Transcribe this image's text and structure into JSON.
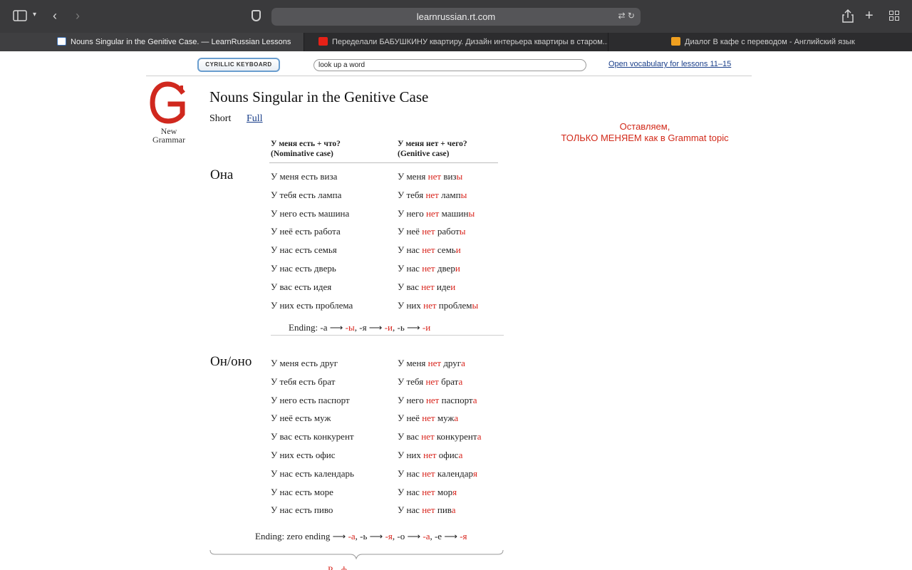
{
  "browser": {
    "url": "learnrussian.rt.com",
    "tabs": [
      {
        "title": "Nouns Singular in the Genitive Case. — LearnRussian Lessons",
        "active": true,
        "favicon": "lr-icon"
      },
      {
        "title": "Переделали БАБУШКИНУ квартиру. Дизайн интерьера квартиры в старом...",
        "active": false,
        "favicon": "youtube-icon"
      },
      {
        "title": "Диалог В кафе с переводом - Английский язык",
        "active": false,
        "favicon": "site-icon"
      }
    ]
  },
  "page": {
    "keyboard_button": "CYRILLIC KEYBOARD",
    "lookup_value": "look up a word",
    "vocab_link": "Open vocabulary for lessons 11–15",
    "logo_caption_1": "New",
    "logo_caption_2": "Grammar",
    "title": "Nouns Singular in the Genitive Case",
    "mode_short": "Short",
    "mode_full": "Full",
    "note_line1": "Оставляем,",
    "note_line2": "ТОЛЬКО МЕНЯЕМ как в Grammat topic",
    "col1_head1": "У меня есть + что?",
    "col1_head2": "(Nominative case)",
    "col2_head1": "У меня нет + чего?",
    "col2_head2": "(Genitive case)"
  },
  "sections": [
    {
      "pronoun": "Она",
      "rows": [
        {
          "left": "У меня есть виза",
          "r_pre": "У меня ",
          "r_neg": "нет",
          "r_stem": " виз",
          "r_end": "ы"
        },
        {
          "left": "У тебя есть лампа",
          "r_pre": "У тебя ",
          "r_neg": "нет",
          "r_stem": " ламп",
          "r_end": "ы"
        },
        {
          "left": "У него есть машина",
          "r_pre": "У него ",
          "r_neg": "нет",
          "r_stem": " машин",
          "r_end": "ы"
        },
        {
          "left": "У неё есть работа",
          "r_pre": "У неё ",
          "r_neg": "нет",
          "r_stem": " работ",
          "r_end": "ы"
        },
        {
          "left": "У нас есть семья",
          "r_pre": "У нас ",
          "r_neg": "нет",
          "r_stem": " семь",
          "r_end": "и"
        },
        {
          "left": "У нас есть дверь",
          "r_pre": "У нас ",
          "r_neg": "нет",
          "r_stem": " двер",
          "r_end": "и"
        },
        {
          "left": "У вас есть идея",
          "r_pre": "У вас ",
          "r_neg": "нет",
          "r_stem": " иде",
          "r_end": "и"
        },
        {
          "left": "У них есть проблема",
          "r_pre": "У них ",
          "r_neg": "нет",
          "r_stem": " проблем",
          "r_end": "ы"
        }
      ],
      "ending": [
        {
          "t": "Ending: -а ⟶ ",
          "red": false
        },
        {
          "t": "-ы",
          "red": true
        },
        {
          "t": ", -я ⟶ ",
          "red": false
        },
        {
          "t": "-и",
          "red": true
        },
        {
          "t": ", -ь ⟶ ",
          "red": false
        },
        {
          "t": "-и",
          "red": true
        }
      ]
    },
    {
      "pronoun": "Он/оно",
      "rows": [
        {
          "left": "У меня есть друг",
          "r_pre": "У меня ",
          "r_neg": "нет",
          "r_stem": " друг",
          "r_end": "а"
        },
        {
          "left": "У тебя есть брат",
          "r_pre": "У тебя ",
          "r_neg": "нет",
          "r_stem": " брат",
          "r_end": "а"
        },
        {
          "left": "У него есть паспорт",
          "r_pre": "У него ",
          "r_neg": "нет",
          "r_stem": " паспорт",
          "r_end": "а"
        },
        {
          "left": "У неё есть муж",
          "r_pre": "У неё ",
          "r_neg": "нет",
          "r_stem": " муж",
          "r_end": "а"
        },
        {
          "left": "У вас есть конкурент",
          "r_pre": "У вас ",
          "r_neg": "нет",
          "r_stem": " конкурент",
          "r_end": "а"
        },
        {
          "left": "У них есть офис",
          "r_pre": "У них ",
          "r_neg": "нет",
          "r_stem": " офис",
          "r_end": "а"
        },
        {
          "left": "У нас есть календарь",
          "r_pre": "У нас ",
          "r_neg": "нет",
          "r_stem": " календар",
          "r_end": "я"
        },
        {
          "left": "У нас есть море",
          "r_pre": "У нас ",
          "r_neg": "нет",
          "r_stem": " мор",
          "r_end": "я"
        },
        {
          "left": "У нас есть пиво",
          "r_pre": "У нас ",
          "r_neg": "нет",
          "r_stem": " пив",
          "r_end": "а"
        }
      ],
      "ending": [
        {
          "t": "Ending: zero ending ⟶ ",
          "red": false
        },
        {
          "t": "-а",
          "red": true
        },
        {
          "t": ", -ь ⟶ ",
          "red": false
        },
        {
          "t": "-я",
          "red": true
        },
        {
          "t": ", -о ⟶ ",
          "red": false
        },
        {
          "t": "-а",
          "red": true
        },
        {
          "t": ", -е ⟶ ",
          "red": false
        },
        {
          "t": "-я",
          "red": true
        }
      ]
    }
  ],
  "bottom_fragment": "Р... ф",
  "colors": {
    "accent_red": "#d8231b",
    "link_blue": "#1a3f8a"
  }
}
